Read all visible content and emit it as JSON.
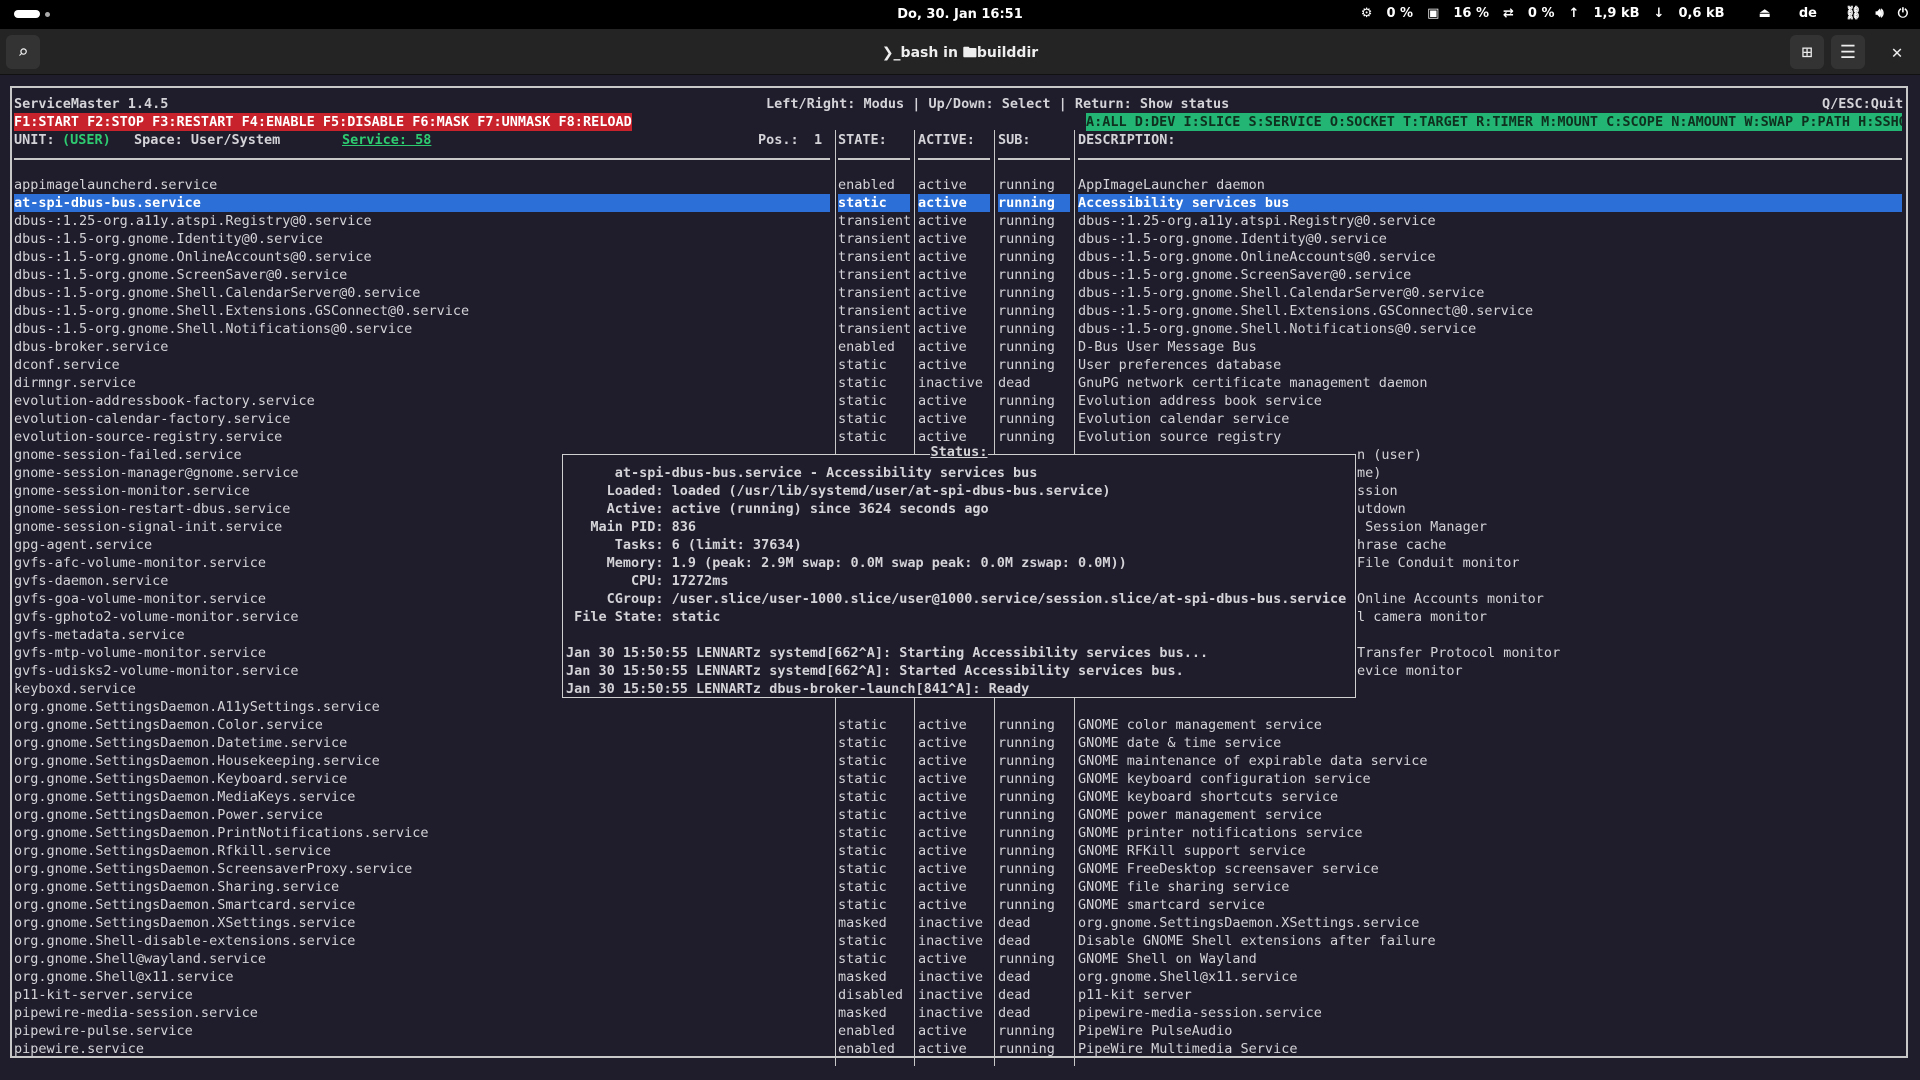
{
  "topbar": {
    "clock": "Do, 30. Jan 16:51",
    "cpu": "0 %",
    "mem": "16 %",
    "swap": "0 %",
    "net_up": "1,9 kB",
    "net_down": "0,6 kB",
    "lang": "de"
  },
  "header": {
    "title": "❯_bash in 🖿builddir",
    "icons": [
      "search-icon",
      "new-tab-icon",
      "menu-icon",
      "close-icon"
    ]
  },
  "app": {
    "name": "ServiceMaster 1.4.5",
    "help": "Left/Right: Modus | Up/Down: Select | Return: Show status",
    "quit": "Q/ESC:Quit",
    "fkeys": "F1:START F2:STOP F3:RESTART F4:ENABLE F5:DISABLE F6:MASK F7:UNMASK F8:RELOAD",
    "filters": "A:ALL D:DEV I:SLICE S:SERVICE O:SOCKET T:TARGET R:TIMER M:MOUNT C:SCOPE N:AMOUNT W:SWAP P:PATH H:SSHOT",
    "unit_label": "UNIT:",
    "unit_value": "(USER)",
    "space": "Space: User/System",
    "service_count": "Service: 58",
    "pos_label": "Pos.:",
    "pos_value": "1",
    "headers": {
      "state": "STATE:",
      "active": "ACTIVE:",
      "sub": "SUB:",
      "desc": "DESCRIPTION:"
    },
    "colors": {
      "fkeys_bg": "#c8232c",
      "filters_bg": "#22b573",
      "selected_bg": "#2c6fd6"
    }
  },
  "rows": [
    [
      "appimagelauncherd.service",
      "enabled",
      "active",
      "running",
      "AppImageLauncher daemon"
    ],
    [
      "at-spi-dbus-bus.service",
      "static",
      "active",
      "running",
      "Accessibility services bus"
    ],
    [
      "dbus-:1.25-org.a11y.atspi.Registry@0.service",
      "transient",
      "active",
      "running",
      "dbus-:1.25-org.a11y.atspi.Registry@0.service"
    ],
    [
      "dbus-:1.5-org.gnome.Identity@0.service",
      "transient",
      "active",
      "running",
      "dbus-:1.5-org.gnome.Identity@0.service"
    ],
    [
      "dbus-:1.5-org.gnome.OnlineAccounts@0.service",
      "transient",
      "active",
      "running",
      "dbus-:1.5-org.gnome.OnlineAccounts@0.service"
    ],
    [
      "dbus-:1.5-org.gnome.ScreenSaver@0.service",
      "transient",
      "active",
      "running",
      "dbus-:1.5-org.gnome.ScreenSaver@0.service"
    ],
    [
      "dbus-:1.5-org.gnome.Shell.CalendarServer@0.service",
      "transient",
      "active",
      "running",
      "dbus-:1.5-org.gnome.Shell.CalendarServer@0.service"
    ],
    [
      "dbus-:1.5-org.gnome.Shell.Extensions.GSConnect@0.service",
      "transient",
      "active",
      "running",
      "dbus-:1.5-org.gnome.Shell.Extensions.GSConnect@0.service"
    ],
    [
      "dbus-:1.5-org.gnome.Shell.Notifications@0.service",
      "transient",
      "active",
      "running",
      "dbus-:1.5-org.gnome.Shell.Notifications@0.service"
    ],
    [
      "dbus-broker.service",
      "enabled",
      "active",
      "running",
      "D-Bus User Message Bus"
    ],
    [
      "dconf.service",
      "static",
      "active",
      "running",
      "User preferences database"
    ],
    [
      "dirmngr.service",
      "static",
      "inactive",
      "dead",
      "GnuPG network certificate management daemon"
    ],
    [
      "evolution-addressbook-factory.service",
      "static",
      "active",
      "running",
      "Evolution address book service"
    ],
    [
      "evolution-calendar-factory.service",
      "static",
      "active",
      "running",
      "Evolution calendar service"
    ],
    [
      "evolution-source-registry.service",
      "static",
      "active",
      "running",
      "Evolution source registry"
    ],
    [
      "gnome-session-failed.service",
      "",
      "",
      "",
      "",
      "n (user)"
    ],
    [
      "gnome-session-manager@gnome.service",
      "",
      "",
      "",
      "",
      "me)"
    ],
    [
      "gnome-session-monitor.service",
      "",
      "",
      "",
      "",
      "ssion"
    ],
    [
      "gnome-session-restart-dbus.service",
      "",
      "",
      "",
      "",
      "utdown"
    ],
    [
      "gnome-session-signal-init.service",
      "",
      "",
      "",
      "",
      " Session Manager"
    ],
    [
      "gpg-agent.service",
      "",
      "",
      "",
      "",
      "hrase cache"
    ],
    [
      "gvfs-afc-volume-monitor.service",
      "",
      "",
      "",
      "",
      "File Conduit monitor"
    ],
    [
      "gvfs-daemon.service",
      "",
      "",
      "",
      "",
      ""
    ],
    [
      "gvfs-goa-volume-monitor.service",
      "",
      "",
      "",
      "",
      "Online Accounts monitor"
    ],
    [
      "gvfs-gphoto2-volume-monitor.service",
      "",
      "",
      "",
      "",
      "l camera monitor"
    ],
    [
      "gvfs-metadata.service",
      "",
      "",
      "",
      "",
      ""
    ],
    [
      "gvfs-mtp-volume-monitor.service",
      "",
      "",
      "",
      "",
      "Transfer Protocol monitor"
    ],
    [
      "gvfs-udisks2-volume-monitor.service",
      "",
      "",
      "",
      "",
      "evice monitor"
    ],
    [
      "keyboxd.service",
      "",
      "",
      "",
      "",
      ""
    ],
    [
      "org.gnome.SettingsDaemon.A11ySettings.service",
      "",
      "",
      "",
      "",
      ""
    ],
    [
      "org.gnome.SettingsDaemon.Color.service",
      "static",
      "active",
      "running",
      "GNOME color management service"
    ],
    [
      "org.gnome.SettingsDaemon.Datetime.service",
      "static",
      "active",
      "running",
      "GNOME date & time service"
    ],
    [
      "org.gnome.SettingsDaemon.Housekeeping.service",
      "static",
      "active",
      "running",
      "GNOME maintenance of expirable data service"
    ],
    [
      "org.gnome.SettingsDaemon.Keyboard.service",
      "static",
      "active",
      "running",
      "GNOME keyboard configuration service"
    ],
    [
      "org.gnome.SettingsDaemon.MediaKeys.service",
      "static",
      "active",
      "running",
      "GNOME keyboard shortcuts service"
    ],
    [
      "org.gnome.SettingsDaemon.Power.service",
      "static",
      "active",
      "running",
      "GNOME power management service"
    ],
    [
      "org.gnome.SettingsDaemon.PrintNotifications.service",
      "static",
      "active",
      "running",
      "GNOME printer notifications service"
    ],
    [
      "org.gnome.SettingsDaemon.Rfkill.service",
      "static",
      "active",
      "running",
      "GNOME RFKill support service"
    ],
    [
      "org.gnome.SettingsDaemon.ScreensaverProxy.service",
      "static",
      "active",
      "running",
      "GNOME FreeDesktop screensaver service"
    ],
    [
      "org.gnome.SettingsDaemon.Sharing.service",
      "static",
      "active",
      "running",
      "GNOME file sharing service"
    ],
    [
      "org.gnome.SettingsDaemon.Smartcard.service",
      "static",
      "active",
      "running",
      "GNOME smartcard service"
    ],
    [
      "org.gnome.SettingsDaemon.XSettings.service",
      "masked",
      "inactive",
      "dead",
      "org.gnome.SettingsDaemon.XSettings.service"
    ],
    [
      "org.gnome.Shell-disable-extensions.service",
      "static",
      "inactive",
      "dead",
      "Disable GNOME Shell extensions after failure"
    ],
    [
      "org.gnome.Shell@wayland.service",
      "static",
      "active",
      "running",
      "GNOME Shell on Wayland"
    ],
    [
      "org.gnome.Shell@x11.service",
      "masked",
      "inactive",
      "dead",
      "org.gnome.Shell@x11.service"
    ],
    [
      "p11-kit-server.service",
      "disabled",
      "inactive",
      "dead",
      "p11-kit server"
    ],
    [
      "pipewire-media-session.service",
      "masked",
      "inactive",
      "dead",
      "pipewire-media-session.service"
    ],
    [
      "pipewire-pulse.service",
      "enabled",
      "active",
      "running",
      "PipeWire PulseAudio"
    ],
    [
      "pipewire.service",
      "enabled",
      "active",
      "running",
      "PipeWire Multimedia Service"
    ]
  ],
  "selected_index": 1,
  "status": {
    "title": "Status:",
    "lines": [
      "      at-spi-dbus-bus.service - Accessibility services bus",
      "     Loaded: loaded (/usr/lib/systemd/user/at-spi-dbus-bus.service)",
      "     Active: active (running) since 3624 seconds ago",
      "   Main PID: 836",
      "      Tasks: 6 (limit: 37634)",
      "     Memory: 1.9 (peak: 2.9M swap: 0.0M swap peak: 0.0M zswap: 0.0M))",
      "        CPU: 17272ms",
      "     CGroup: /user.slice/user-1000.slice/user@1000.service/session.slice/at-spi-dbus-bus.service",
      " File State: static",
      "",
      "Jan 30 15:50:55 LENNARTz systemd[662^A]: Starting Accessibility services bus...",
      "Jan 30 15:50:55 LENNARTz systemd[662^A]: Started Accessibility services bus.",
      "Jan 30 15:50:55 LENNARTz dbus-broker-launch[841^A]: Ready"
    ]
  }
}
